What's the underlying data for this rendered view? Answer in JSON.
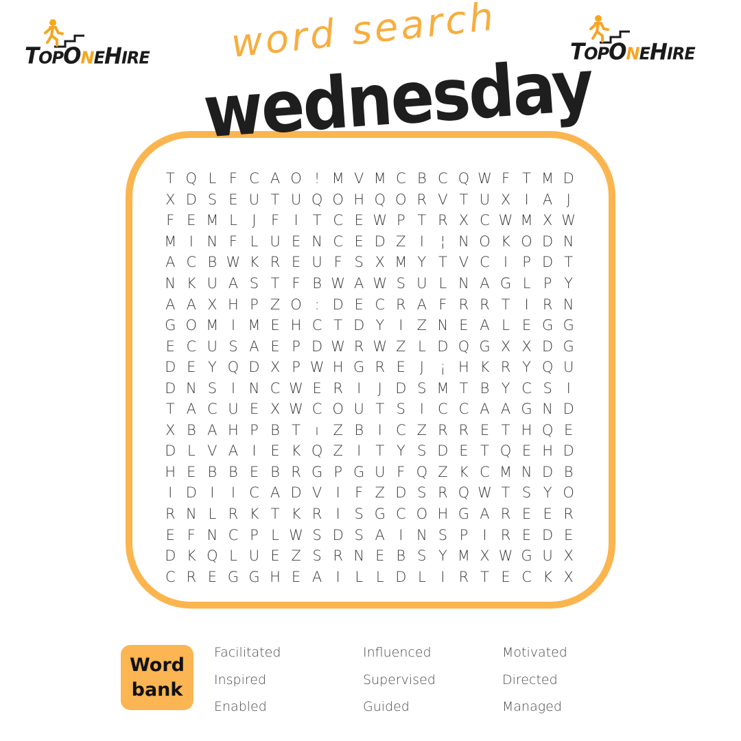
{
  "brand": {
    "logo_text_parts": [
      "T",
      "OP",
      "O",
      "N",
      "E",
      "H",
      "IRE"
    ],
    "accent_color": "#fbb54e",
    "logo_accent_color": "#f5a623"
  },
  "header": {
    "subtitle": "word search",
    "title": "wednesday"
  },
  "grid": {
    "rows": [
      [
        "T",
        "Q",
        "L",
        "F",
        "C",
        "A",
        "O",
        "!",
        "M",
        "V",
        "M",
        "C",
        "B",
        "C",
        "Q",
        "W",
        "F",
        "T",
        "M",
        "D"
      ],
      [
        "X",
        "D",
        "S",
        "E",
        "U",
        "T",
        "U",
        "Q",
        "O",
        "H",
        "Q",
        "O",
        "R",
        "V",
        "T",
        "U",
        "X",
        "I",
        "A",
        "J"
      ],
      [
        "F",
        "E",
        "M",
        "L",
        "J",
        "F",
        "I",
        "T",
        "C",
        "E",
        "W",
        "P",
        "T",
        "R",
        "X",
        "C",
        "W",
        "M",
        "X",
        "W"
      ],
      [
        "M",
        "I",
        "N",
        "F",
        "L",
        "U",
        "E",
        "N",
        "C",
        "E",
        "D",
        "Z",
        "I",
        "¦",
        "N",
        "O",
        "K",
        "O",
        "D",
        "N"
      ],
      [
        "A",
        "C",
        "B",
        "W",
        "K",
        "R",
        "E",
        "U",
        "F",
        "S",
        "X",
        "M",
        "Y",
        "T",
        "V",
        "C",
        "I",
        "P",
        "D",
        "T"
      ],
      [
        "N",
        "K",
        "U",
        "A",
        "S",
        "T",
        "F",
        "B",
        "W",
        "A",
        "W",
        "S",
        "U",
        "L",
        "N",
        "A",
        "G",
        "L",
        "P",
        "Y"
      ],
      [
        "A",
        "A",
        "X",
        "H",
        "P",
        "Z",
        "O",
        ":",
        "D",
        "E",
        "C",
        "R",
        "A",
        "F",
        "R",
        "R",
        "T",
        "I",
        "R",
        "N"
      ],
      [
        "G",
        "O",
        "M",
        "I",
        "M",
        "E",
        "H",
        "C",
        "T",
        "D",
        "Y",
        "I",
        "Z",
        "N",
        "E",
        "A",
        "L",
        "E",
        "G",
        "G"
      ],
      [
        "E",
        "C",
        "U",
        "S",
        "A",
        "E",
        "P",
        "D",
        "W",
        "R",
        "W",
        "Z",
        "L",
        "D",
        "Q",
        "G",
        "X",
        "X",
        "D",
        "G"
      ],
      [
        "D",
        "E",
        "Y",
        "Q",
        "D",
        "X",
        "P",
        "W",
        "H",
        "G",
        "R",
        "E",
        "J",
        "¡",
        "H",
        "K",
        "R",
        "Y",
        "Q",
        "U"
      ],
      [
        "D",
        "N",
        "S",
        "I",
        "N",
        "C",
        "W",
        "E",
        "R",
        "I",
        "J",
        "D",
        "S",
        "M",
        "T",
        "B",
        "Y",
        "C",
        "S",
        "I"
      ],
      [
        "T",
        "A",
        "C",
        "U",
        "E",
        "X",
        "W",
        "C",
        "O",
        "U",
        "T",
        "S",
        "I",
        "C",
        "C",
        "A",
        "A",
        "G",
        "N",
        "D"
      ],
      [
        "X",
        "B",
        "A",
        "H",
        "P",
        "B",
        "T",
        "ı",
        "Z",
        "B",
        "I",
        "C",
        "Z",
        "R",
        "R",
        "E",
        "T",
        "H",
        "Q",
        "E"
      ],
      [
        "D",
        "L",
        "V",
        "A",
        "I",
        "E",
        "K",
        "Q",
        "Z",
        "I",
        "T",
        "Y",
        "S",
        "D",
        "E",
        "T",
        "Q",
        "E",
        "H",
        "D"
      ],
      [
        "H",
        "E",
        "B",
        "B",
        "E",
        "B",
        "R",
        "G",
        "P",
        "G",
        "U",
        "F",
        "Q",
        "Z",
        "K",
        "C",
        "M",
        "N",
        "D",
        "B"
      ],
      [
        "I",
        "D",
        "I",
        "I",
        "C",
        "A",
        "D",
        "V",
        "I",
        "F",
        "Z",
        "D",
        "S",
        "R",
        "Q",
        "W",
        "T",
        "S",
        "Y",
        "O"
      ],
      [
        "R",
        "N",
        "L",
        "R",
        "K",
        "T",
        "K",
        "R",
        "I",
        "S",
        "G",
        "C",
        "O",
        "H",
        "G",
        "A",
        "R",
        "E",
        "E",
        "R"
      ],
      [
        "E",
        "F",
        "N",
        "C",
        "P",
        "L",
        "W",
        "S",
        "D",
        "S",
        "A",
        "I",
        "N",
        "S",
        "P",
        "I",
        "R",
        "E",
        "D",
        "E"
      ],
      [
        "D",
        "K",
        "Q",
        "L",
        "U",
        "E",
        "Z",
        "S",
        "R",
        "N",
        "E",
        "B",
        "S",
        "Y",
        "M",
        "X",
        "W",
        "G",
        "U",
        "X"
      ],
      [
        "C",
        "R",
        "E",
        "G",
        "G",
        "H",
        "E",
        "A",
        "I",
        "L",
        "L",
        "D",
        "L",
        "I",
        "R",
        "T",
        "E",
        "C",
        "K",
        "X"
      ]
    ]
  },
  "word_bank": {
    "label_line1": "Word",
    "label_line2": "bank",
    "columns": [
      [
        "Facilitated",
        "Inspired",
        "Enabled"
      ],
      [
        "Influenced",
        "Supervised",
        "Guided"
      ],
      [
        "Motivated",
        "Directed",
        "Managed"
      ]
    ]
  }
}
